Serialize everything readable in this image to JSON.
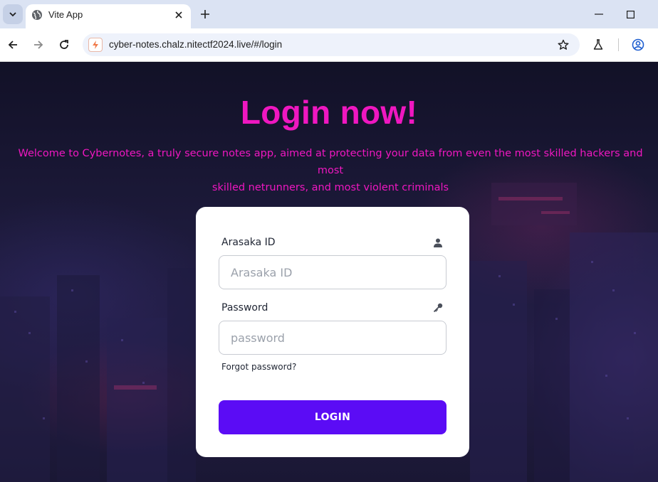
{
  "browser": {
    "tab_title": "Vite App",
    "url": "cyber-notes.chalz.nitectf2024.live/#/login"
  },
  "page": {
    "heading": "Login now!",
    "subtitle_line1": "Welcome to Cybernotes, a truly secure notes app, aimed at protecting your data from even the most skilled hackers and most",
    "subtitle_line2": "skilled netrunners, and most violent criminals"
  },
  "form": {
    "id_label": "Arasaka ID",
    "id_placeholder": "Arasaka ID",
    "password_label": "Password",
    "password_placeholder": "password",
    "forgot_label": "Forgot password?",
    "login_label": "LOGIN"
  },
  "colors": {
    "accent_pink": "#ef17c0",
    "button_purple": "#5b0cf5",
    "card_bg": "#ffffff"
  },
  "icons": {
    "id_field": "user-icon",
    "password_field": "key-icon"
  }
}
